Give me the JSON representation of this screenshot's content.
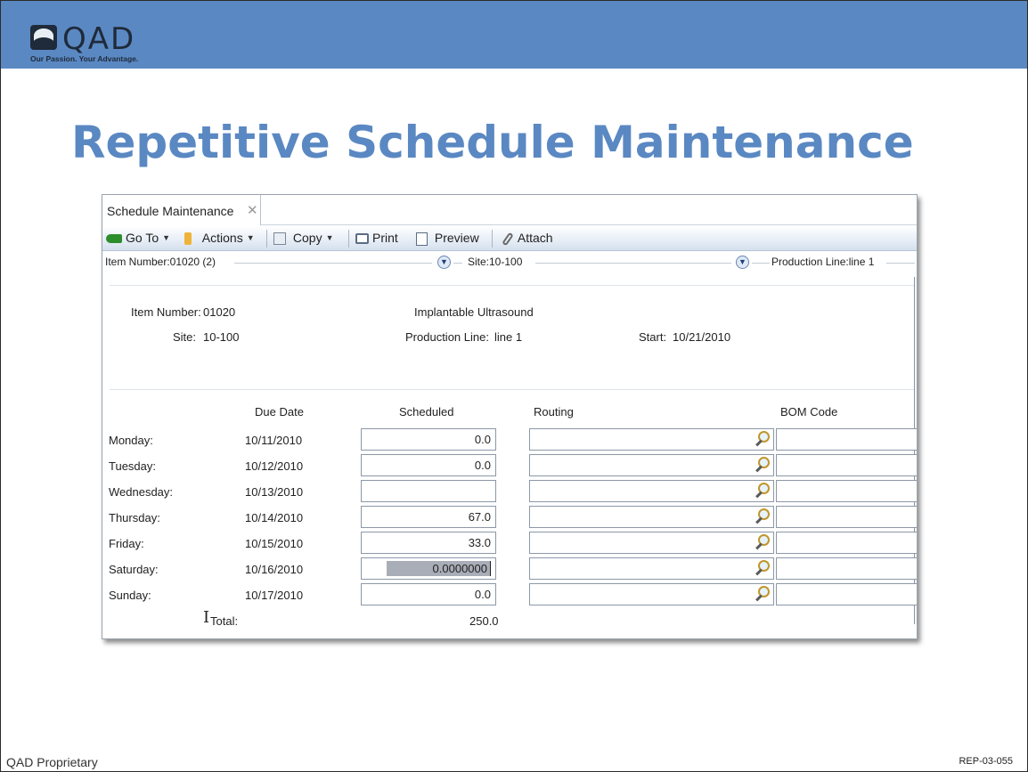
{
  "slide": {
    "logo_word": "QAD",
    "logo_tagline": "Our Passion. Your Advantage.",
    "title": "Repetitive Schedule Maintenance",
    "footer_left": "QAD Proprietary",
    "footer_right": "REP-03-055",
    "colors": {
      "band": "#5a88c2",
      "title": "#5a88c2"
    }
  },
  "app": {
    "tab_label": "Schedule Maintenance",
    "tab_close_icon": "close-icon",
    "toolbar": {
      "goto": "Go To",
      "actions": "Actions",
      "copy": "Copy",
      "print": "Print",
      "preview": "Preview",
      "attach": "Attach"
    },
    "filter": {
      "item": "Item Number:01020 (2)",
      "site": "Site:10-100",
      "line": "Production Line:line 1"
    },
    "header": {
      "item_label": "Item Number:",
      "item_value": "01020",
      "description": "Implantable Ultrasound",
      "site_label": "Site:",
      "site_value": "10-100",
      "line_label": "Production Line:",
      "line_value": "line 1",
      "start_label": "Start:",
      "start_value": "10/21/2010"
    },
    "grid": {
      "headers": {
        "due": "Due Date",
        "scheduled": "Scheduled",
        "routing": "Routing",
        "bom": "BOM Code"
      },
      "rows": [
        {
          "day": "Monday:",
          "due": "10/11/2010",
          "scheduled": "0.0"
        },
        {
          "day": "Tuesday:",
          "due": "10/12/2010",
          "scheduled": "0.0"
        },
        {
          "day": "Wednesday:",
          "due": "10/13/2010",
          "scheduled": ""
        },
        {
          "day": "Thursday:",
          "due": "10/14/2010",
          "scheduled": "67.0"
        },
        {
          "day": "Friday:",
          "due": "10/15/2010",
          "scheduled": "33.0"
        },
        {
          "day": "Saturday:",
          "due": "10/16/2010",
          "scheduled": "0.0000000"
        },
        {
          "day": "Sunday:",
          "due": "10/17/2010",
          "scheduled": "0.0"
        }
      ],
      "total_label": "Total:",
      "total_value": "250.0"
    }
  }
}
